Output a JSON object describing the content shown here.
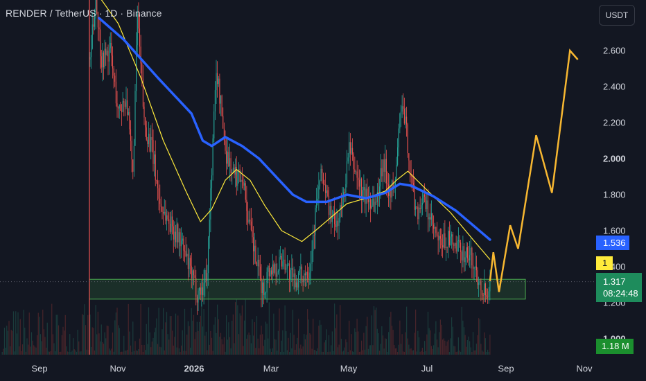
{
  "header": {
    "title": "RENDER / TetherUS · 1D · Binance",
    "currency_button": "USDT"
  },
  "axis": {
    "y_ticks": [
      {
        "label": "2.600",
        "value": 2.6,
        "bold": false
      },
      {
        "label": "2.400",
        "value": 2.4,
        "bold": false
      },
      {
        "label": "2.200",
        "value": 2.2,
        "bold": false
      },
      {
        "label": "2.000",
        "value": 2.0,
        "bold": true
      },
      {
        "label": "1.800",
        "value": 1.8,
        "bold": false
      },
      {
        "label": "1.600",
        "value": 1.6,
        "bold": false
      },
      {
        "label": "1.400",
        "value": 1.4,
        "bold": false
      },
      {
        "label": "1.200",
        "value": 1.2,
        "bold": false
      },
      {
        "label": "1.000",
        "value": 1.0,
        "bold": true
      }
    ],
    "x_ticks": [
      {
        "label": "Sep",
        "bold": false
      },
      {
        "label": "Nov",
        "bold": false
      },
      {
        "label": "2026",
        "bold": true
      },
      {
        "label": "Mar",
        "bold": false
      },
      {
        "label": "May",
        "bold": false
      },
      {
        "label": "Jul",
        "bold": false
      },
      {
        "label": "Sep",
        "bold": false
      },
      {
        "label": "Nov",
        "bold": false
      }
    ]
  },
  "price_tags": {
    "ma_slow": "1.536",
    "ma_fast": "1",
    "last_price": "1.317",
    "countdown": "08:24:48",
    "volume": "1.18 M"
  },
  "colors": {
    "background": "#131722",
    "ma_slow": "#2962ff",
    "ma_fast": "#ffeb3b",
    "projection": "#f7b731",
    "candle_up": "#26a69a",
    "candle_down": "#ef5350",
    "support_zone": "#4caf50"
  },
  "chart_data": {
    "type": "candlestick",
    "symbol": "RENDER / TetherUS",
    "interval": "1D",
    "exchange": "Binance",
    "y_range": [
      1.0,
      2.6
    ],
    "last_price": 1.317,
    "support_zone": [
      1.22,
      1.33
    ],
    "ma_slow": {
      "color": "#2962ff",
      "last": 1.536,
      "points": [
        {
          "d": 8,
          "v": 2.78
        },
        {
          "d": 30,
          "v": 2.66
        },
        {
          "d": 60,
          "v": 2.45
        },
        {
          "d": 90,
          "v": 2.25
        },
        {
          "d": 100,
          "v": 2.1
        },
        {
          "d": 108,
          "v": 2.07
        },
        {
          "d": 120,
          "v": 2.12
        },
        {
          "d": 135,
          "v": 2.07
        },
        {
          "d": 150,
          "v": 2.0
        },
        {
          "d": 165,
          "v": 1.9
        },
        {
          "d": 180,
          "v": 1.8
        },
        {
          "d": 192,
          "v": 1.76
        },
        {
          "d": 210,
          "v": 1.76
        },
        {
          "d": 228,
          "v": 1.8
        },
        {
          "d": 245,
          "v": 1.78
        },
        {
          "d": 262,
          "v": 1.81
        },
        {
          "d": 275,
          "v": 1.86
        },
        {
          "d": 285,
          "v": 1.85
        },
        {
          "d": 305,
          "v": 1.79
        },
        {
          "d": 325,
          "v": 1.71
        },
        {
          "d": 340,
          "v": 1.63
        },
        {
          "d": 355,
          "v": 1.55
        }
      ]
    },
    "ma_fast": {
      "color": "#ffeb3b",
      "last": 1.44,
      "points": [
        {
          "d": 8,
          "v": 2.9
        },
        {
          "d": 25,
          "v": 2.75
        },
        {
          "d": 45,
          "v": 2.45
        },
        {
          "d": 65,
          "v": 2.1
        },
        {
          "d": 85,
          "v": 1.82
        },
        {
          "d": 98,
          "v": 1.65
        },
        {
          "d": 108,
          "v": 1.72
        },
        {
          "d": 120,
          "v": 1.88
        },
        {
          "d": 130,
          "v": 1.94
        },
        {
          "d": 142,
          "v": 1.88
        },
        {
          "d": 155,
          "v": 1.74
        },
        {
          "d": 170,
          "v": 1.6
        },
        {
          "d": 188,
          "v": 1.54
        },
        {
          "d": 200,
          "v": 1.6
        },
        {
          "d": 215,
          "v": 1.68
        },
        {
          "d": 228,
          "v": 1.75
        },
        {
          "d": 245,
          "v": 1.78
        },
        {
          "d": 262,
          "v": 1.82
        },
        {
          "d": 272,
          "v": 1.88
        },
        {
          "d": 282,
          "v": 1.93
        },
        {
          "d": 300,
          "v": 1.82
        },
        {
          "d": 320,
          "v": 1.7
        },
        {
          "d": 340,
          "v": 1.55
        },
        {
          "d": 355,
          "v": 1.44
        }
      ]
    },
    "projection": {
      "color": "#f7b731",
      "points": [
        {
          "d": 355,
          "v": 1.32
        },
        {
          "d": 358,
          "v": 1.48
        },
        {
          "d": 363,
          "v": 1.26
        },
        {
          "d": 373,
          "v": 1.63
        },
        {
          "d": 380,
          "v": 1.5
        },
        {
          "d": 396,
          "v": 2.13
        },
        {
          "d": 410,
          "v": 1.81
        },
        {
          "d": 426,
          "v": 2.6
        },
        {
          "d": 433,
          "v": 2.55
        }
      ]
    },
    "price_path": [
      {
        "d": 0,
        "v": 2.55
      },
      {
        "d": 5,
        "v": 2.9
      },
      {
        "d": 10,
        "v": 2.55
      },
      {
        "d": 18,
        "v": 2.6
      },
      {
        "d": 25,
        "v": 2.25
      },
      {
        "d": 32,
        "v": 2.35
      },
      {
        "d": 38,
        "v": 1.9
      },
      {
        "d": 42,
        "v": 2.8
      },
      {
        "d": 48,
        "v": 2.2
      },
      {
        "d": 55,
        "v": 2.05
      },
      {
        "d": 62,
        "v": 1.75
      },
      {
        "d": 70,
        "v": 1.65
      },
      {
        "d": 80,
        "v": 1.55
      },
      {
        "d": 90,
        "v": 1.35
      },
      {
        "d": 95,
        "v": 1.26
      },
      {
        "d": 100,
        "v": 1.28
      },
      {
        "d": 104,
        "v": 1.4
      },
      {
        "d": 108,
        "v": 1.95
      },
      {
        "d": 112,
        "v": 2.5
      },
      {
        "d": 116,
        "v": 2.3
      },
      {
        "d": 120,
        "v": 2.05
      },
      {
        "d": 128,
        "v": 1.9
      },
      {
        "d": 135,
        "v": 1.92
      },
      {
        "d": 142,
        "v": 1.6
      },
      {
        "d": 150,
        "v": 1.35
      },
      {
        "d": 154,
        "v": 1.25
      },
      {
        "d": 158,
        "v": 1.38
      },
      {
        "d": 165,
        "v": 1.4
      },
      {
        "d": 172,
        "v": 1.45
      },
      {
        "d": 180,
        "v": 1.32
      },
      {
        "d": 188,
        "v": 1.35
      },
      {
        "d": 195,
        "v": 1.4
      },
      {
        "d": 202,
        "v": 1.8
      },
      {
        "d": 206,
        "v": 1.92
      },
      {
        "d": 212,
        "v": 1.72
      },
      {
        "d": 218,
        "v": 1.62
      },
      {
        "d": 224,
        "v": 1.75
      },
      {
        "d": 230,
        "v": 2.05
      },
      {
        "d": 236,
        "v": 1.92
      },
      {
        "d": 242,
        "v": 1.8
      },
      {
        "d": 248,
        "v": 1.78
      },
      {
        "d": 254,
        "v": 1.75
      },
      {
        "d": 260,
        "v": 2.0
      },
      {
        "d": 265,
        "v": 1.85
      },
      {
        "d": 270,
        "v": 1.82
      },
      {
        "d": 276,
        "v": 2.3
      },
      {
        "d": 281,
        "v": 2.15
      },
      {
        "d": 285,
        "v": 1.88
      },
      {
        "d": 290,
        "v": 1.7
      },
      {
        "d": 295,
        "v": 1.78
      },
      {
        "d": 300,
        "v": 1.7
      },
      {
        "d": 305,
        "v": 1.6
      },
      {
        "d": 310,
        "v": 1.52
      },
      {
        "d": 318,
        "v": 1.55
      },
      {
        "d": 325,
        "v": 1.5
      },
      {
        "d": 332,
        "v": 1.48
      },
      {
        "d": 338,
        "v": 1.45
      },
      {
        "d": 344,
        "v": 1.35
      },
      {
        "d": 350,
        "v": 1.27
      },
      {
        "d": 355,
        "v": 1.3
      }
    ]
  }
}
